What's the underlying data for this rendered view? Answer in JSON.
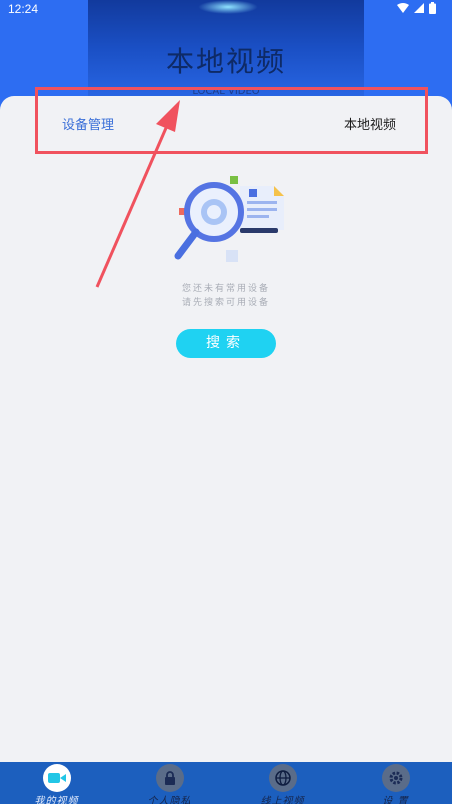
{
  "status_bar": {
    "time": "12:24",
    "icons": [
      "wifi-icon",
      "signal-icon",
      "battery-icon"
    ]
  },
  "header": {
    "title": "本地视频",
    "subtitle": "LOCAL VIDEO"
  },
  "tabs": [
    {
      "label": "设备管理",
      "active": true
    },
    {
      "label": "本地视频",
      "active": false
    }
  ],
  "empty_state": {
    "line1": "您还未有常用设备",
    "line2": "请先搜索可用设备",
    "illustration": "magnifier-document-icon"
  },
  "search_button": {
    "label": "搜索"
  },
  "bottom_nav": [
    {
      "label": "我的视频",
      "icon": "video-camera-icon",
      "active": true
    },
    {
      "label": "个人隐私",
      "icon": "lock-icon",
      "active": false
    },
    {
      "label": "线上视频",
      "icon": "globe-icon",
      "active": false
    },
    {
      "label": "设 置",
      "icon": "gear-icon",
      "active": false
    }
  ],
  "colors": {
    "header": "#2d6df2",
    "accent": "#1fd2f2",
    "nav": "#1c5fbe",
    "highlight": "#f0525e"
  }
}
